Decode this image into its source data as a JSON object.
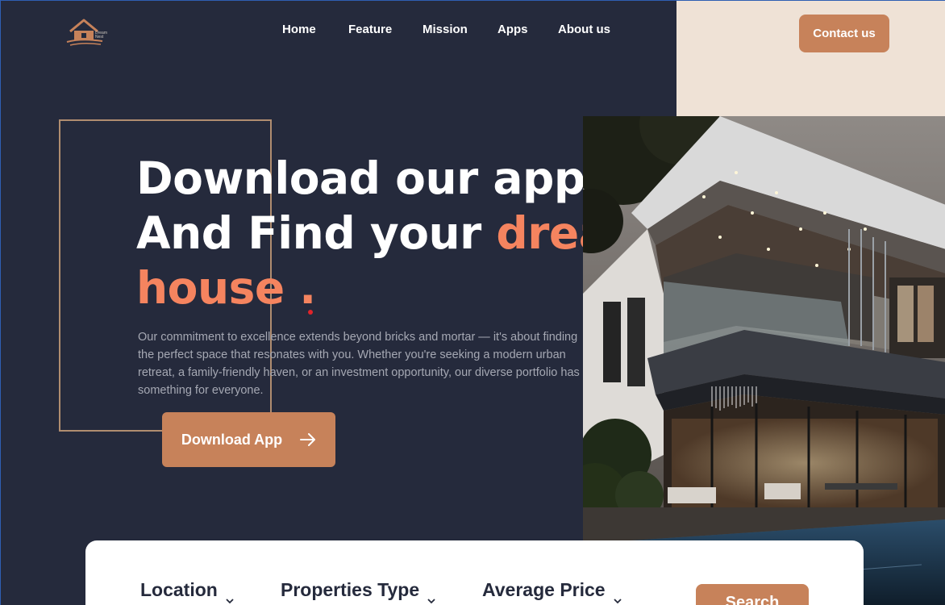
{
  "brand": {
    "logo_text": "Dream Nest"
  },
  "nav": {
    "items": [
      {
        "label": "Home"
      },
      {
        "label": "Feature"
      },
      {
        "label": "Mission"
      },
      {
        "label": "Apps"
      },
      {
        "label": "About us"
      }
    ],
    "contact_label": "Contact us"
  },
  "hero": {
    "line1": "Download our app",
    "line2_prefix": "And  Find your ",
    "line2_accent": "dream",
    "line3_accent": "house",
    "line3_suffix": " .",
    "description": "Our commitment to excellence extends beyond bricks and mortar — it's about finding the perfect space that resonates with you. Whether you're seeking a modern urban retreat, a family-friendly haven, or an investment opportunity, our diverse portfolio has something for everyone.",
    "download_label": "Download App"
  },
  "search": {
    "filters": [
      {
        "label": "Location"
      },
      {
        "label": "Properties Type"
      },
      {
        "label": "Average Price"
      }
    ],
    "button_label": "Search"
  },
  "colors": {
    "background": "#252a3c",
    "accent": "#c7825a",
    "highlight": "#f5845f",
    "cream": "#efe2d6"
  },
  "icons": {
    "logo": "house-logo-icon",
    "arrow": "arrow-right-icon",
    "dropdown": "chevron-down-icon"
  }
}
